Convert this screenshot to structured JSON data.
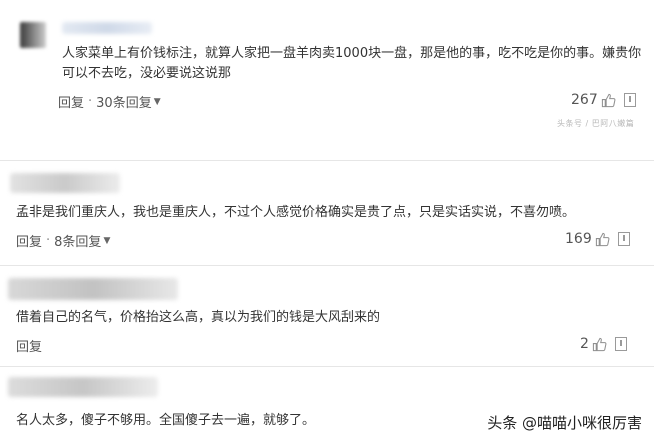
{
  "comments": [
    {
      "text": "人家菜单上有价钱标注，就算人家把一盘羊肉卖1000块一盘，那是他的事，吃不吃是你的事。嫌贵你可以不去吃，没必要说这说那",
      "reply_label": "回复",
      "separator": "·",
      "replies_label": "30条回复",
      "likes": "267"
    },
    {
      "text": "孟非是我们重庆人，我也是重庆人，不过个人感觉价格确实是贵了点，只是实话实说，不喜勿喷。",
      "reply_label": "回复",
      "separator": "·",
      "replies_label": "8条回复",
      "likes": "169"
    },
    {
      "text": "借着自己的名气，价格抬这么高，真以为我们的钱是大风刮来的",
      "reply_label": "回复",
      "likes": "2"
    },
    {
      "text": "名人太多，傻子不够用。全国傻子去一遍，就够了。"
    }
  ],
  "small_watermark": "头条号 / 巴阿八嫩篇",
  "watermark": "头条 @喵喵小咪很厉害",
  "icons": {
    "thumb": "thumbs-up-icon",
    "report": "report-icon",
    "caret": "chevron-down-icon"
  }
}
